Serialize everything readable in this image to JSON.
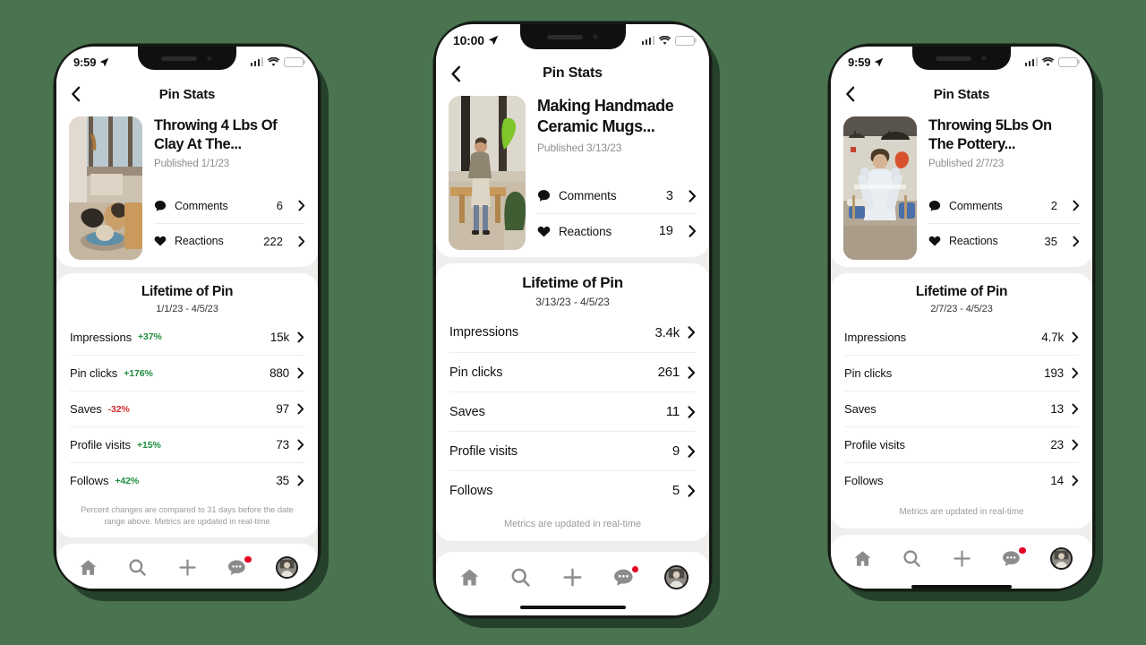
{
  "background_color": "#4a7350",
  "accent_positive": "#1e8e3e",
  "accent_negative": "#d33030",
  "badge_color": "#e60023",
  "common": {
    "nav_title": "Pin Stats",
    "back_icon": "chevron-left-icon",
    "lifetime_title": "Lifetime of Pin",
    "published_prefix": "Published",
    "comments_label": "Comments",
    "reactions_label": "Reactions",
    "comments_icon": "comment-bubble-icon",
    "reactions_icon": "heart-icon",
    "chevron_icon": "chevron-right-icon",
    "footnote_long": "Percent changes are compared to 31 days before the date range above. Metrics are updated in real-time",
    "footnote_short": "Metrics are updated in real-time",
    "metric_names": [
      "Impressions",
      "Pin clicks",
      "Saves",
      "Profile visits",
      "Follows"
    ],
    "tabbar": [
      {
        "name": "home-icon",
        "label": "Home",
        "badge": false
      },
      {
        "name": "search-icon",
        "label": "Search",
        "badge": false
      },
      {
        "name": "plus-icon",
        "label": "Create",
        "badge": false
      },
      {
        "name": "chat-bubble-icon",
        "label": "Messages",
        "badge": true
      },
      {
        "name": "avatar",
        "label": "Profile",
        "badge": false
      }
    ]
  },
  "phones": [
    {
      "id": "phone-1",
      "status": {
        "time": "9:59",
        "location_icon": "location-arrow-icon",
        "signal": "cellular-bars-icon",
        "wifi": "wifi-icon",
        "battery": "battery-low-power-icon"
      },
      "pin": {
        "title": "Throwing 4 Lbs Of Clay At The...",
        "published": "Published 1/1/23",
        "thumbnail_alt": "person throwing clay on a pottery wheel by a window",
        "comments": "6",
        "reactions": "222"
      },
      "lifetime": {
        "title": "Lifetime of Pin",
        "range": "1/1/23 - 4/5/23",
        "metrics": [
          {
            "name": "Impressions",
            "delta": "+37%",
            "delta_dir": "up",
            "value": "15k"
          },
          {
            "name": "Pin clicks",
            "delta": "+176%",
            "delta_dir": "up",
            "value": "880"
          },
          {
            "name": "Saves",
            "delta": "-32%",
            "delta_dir": "down",
            "value": "97"
          },
          {
            "name": "Profile visits",
            "delta": "+15%",
            "delta_dir": "up",
            "value": "73"
          },
          {
            "name": "Follows",
            "delta": "+42%",
            "delta_dir": "up",
            "value": "35"
          }
        ],
        "footnote": "Percent changes are compared to 31 days before the date range above. Metrics are updated in real-time"
      }
    },
    {
      "id": "phone-2",
      "status": {
        "time": "10:00",
        "location_icon": "location-arrow-icon",
        "signal": "cellular-bars-icon",
        "wifi": "wifi-icon",
        "battery": "battery-low-power-icon"
      },
      "pin": {
        "title": "Making Handmade Ceramic Mugs...",
        "published": "Published 3/13/23",
        "thumbnail_alt": "person standing by a sunlit window with a bench and plant",
        "comments": "3",
        "reactions": "19"
      },
      "lifetime": {
        "title": "Lifetime of Pin",
        "range": "3/13/23 - 4/5/23",
        "metrics": [
          {
            "name": "Impressions",
            "delta": "",
            "delta_dir": "",
            "value": "3.4k"
          },
          {
            "name": "Pin clicks",
            "delta": "",
            "delta_dir": "",
            "value": "261"
          },
          {
            "name": "Saves",
            "delta": "",
            "delta_dir": "",
            "value": "11"
          },
          {
            "name": "Profile visits",
            "delta": "",
            "delta_dir": "",
            "value": "9"
          },
          {
            "name": "Follows",
            "delta": "",
            "delta_dir": "",
            "value": "5"
          }
        ],
        "footnote": "Metrics are updated in real-time"
      }
    },
    {
      "id": "phone-3",
      "status": {
        "time": "9:59",
        "location_icon": "location-arrow-icon",
        "signal": "cellular-bars-icon",
        "wifi": "wifi-icon",
        "battery": "battery-low-power-icon"
      },
      "pin": {
        "title": "Throwing 5Lbs On The Pottery...",
        "published": "Published 2/7/23",
        "thumbnail_alt": "person in a pottery studio with pendant lights",
        "comments": "2",
        "reactions": "35"
      },
      "lifetime": {
        "title": "Lifetime of Pin",
        "range": "2/7/23 - 4/5/23",
        "metrics": [
          {
            "name": "Impressions",
            "delta": "",
            "delta_dir": "",
            "value": "4.7k"
          },
          {
            "name": "Pin clicks",
            "delta": "",
            "delta_dir": "",
            "value": "193"
          },
          {
            "name": "Saves",
            "delta": "",
            "delta_dir": "",
            "value": "13"
          },
          {
            "name": "Profile visits",
            "delta": "",
            "delta_dir": "",
            "value": "23"
          },
          {
            "name": "Follows",
            "delta": "",
            "delta_dir": "",
            "value": "14"
          }
        ],
        "footnote": "Metrics are updated in real-time"
      }
    }
  ]
}
